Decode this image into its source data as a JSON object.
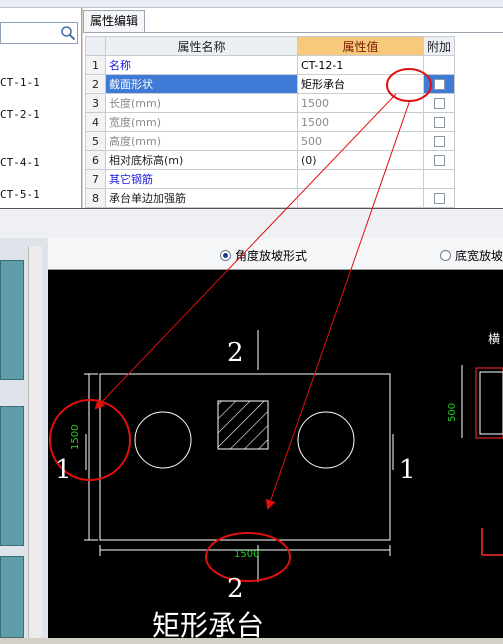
{
  "tree": {
    "items": [
      "CT-1-1",
      "CT-2-1",
      "CT-4-1",
      "CT-5-1"
    ]
  },
  "props": {
    "tab_label": "属性编辑",
    "headers": {
      "name": "属性名称",
      "value": "属性值",
      "extra": "附加"
    },
    "rows": [
      {
        "num": "1",
        "name": "名称",
        "value": "CT-12-1",
        "style": "blue",
        "check": false
      },
      {
        "num": "2",
        "name": "截面形状",
        "value": "矩形承台",
        "style": "sel",
        "check": true
      },
      {
        "num": "3",
        "name": "长度(mm)",
        "value": "1500",
        "style": "gray",
        "check": true
      },
      {
        "num": "4",
        "name": "宽度(mm)",
        "value": "1500",
        "style": "gray",
        "check": true
      },
      {
        "num": "5",
        "name": "高度(mm)",
        "value": "500",
        "style": "gray",
        "check": true
      },
      {
        "num": "6",
        "name": "相对底标高(m)",
        "value": "(0)",
        "style": "dark",
        "check": true
      },
      {
        "num": "7",
        "name": "其它钢筋",
        "value": "",
        "style": "blue",
        "check": false
      },
      {
        "num": "8",
        "name": "承台单边加强筋",
        "value": "",
        "style": "dark",
        "check": false
      }
    ]
  },
  "radio": {
    "opt1": "角度放坡形式",
    "opt2": "底宽放坡"
  },
  "cad": {
    "section_mark_top": "2",
    "section_mark_bottom": "2",
    "section_mark_left": "1",
    "section_mark_right": "1",
    "dim_width": "1500",
    "dim_height": "1500",
    "dim_side": "500",
    "right_label": "横",
    "caption": "矩形承台"
  },
  "colors": {
    "selection": "#3f7ad6",
    "annotation": "#e01010",
    "dimension": "#22cc22",
    "header_value": "#f7c97a"
  }
}
